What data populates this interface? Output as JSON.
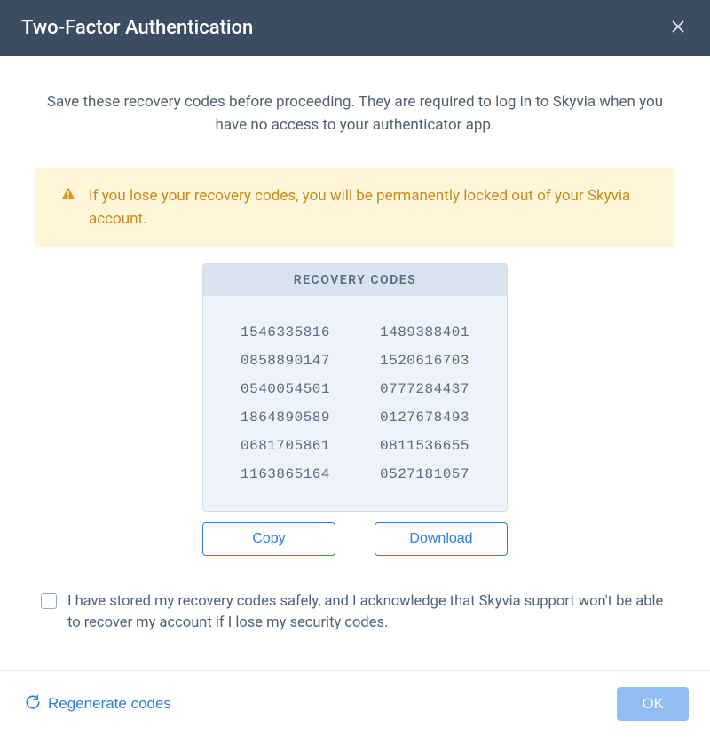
{
  "header": {
    "title": "Two-Factor Authentication"
  },
  "body": {
    "instruction": "Save these recovery codes before proceeding. They are required to log in to Skyvia when you have no access to your authenticator app.",
    "warning": "If you lose your recovery codes, you will be permanently locked out of your Skyvia account.",
    "codes_title": "RECOVERY CODES",
    "codes": [
      "1546335816",
      "1489388401",
      "0858890147",
      "1520616703",
      "0540054501",
      "0777284437",
      "1864890589",
      "0127678493",
      "0681705861",
      "0811536655",
      "1163865164",
      "0527181057"
    ],
    "copy_label": "Copy",
    "download_label": "Download",
    "ack_label": "I have stored my recovery codes safely, and I acknowledge that Skyvia support won't be able to recover my account if I lose my security codes."
  },
  "footer": {
    "regenerate_label": "Regenerate codes",
    "ok_label": "OK"
  }
}
